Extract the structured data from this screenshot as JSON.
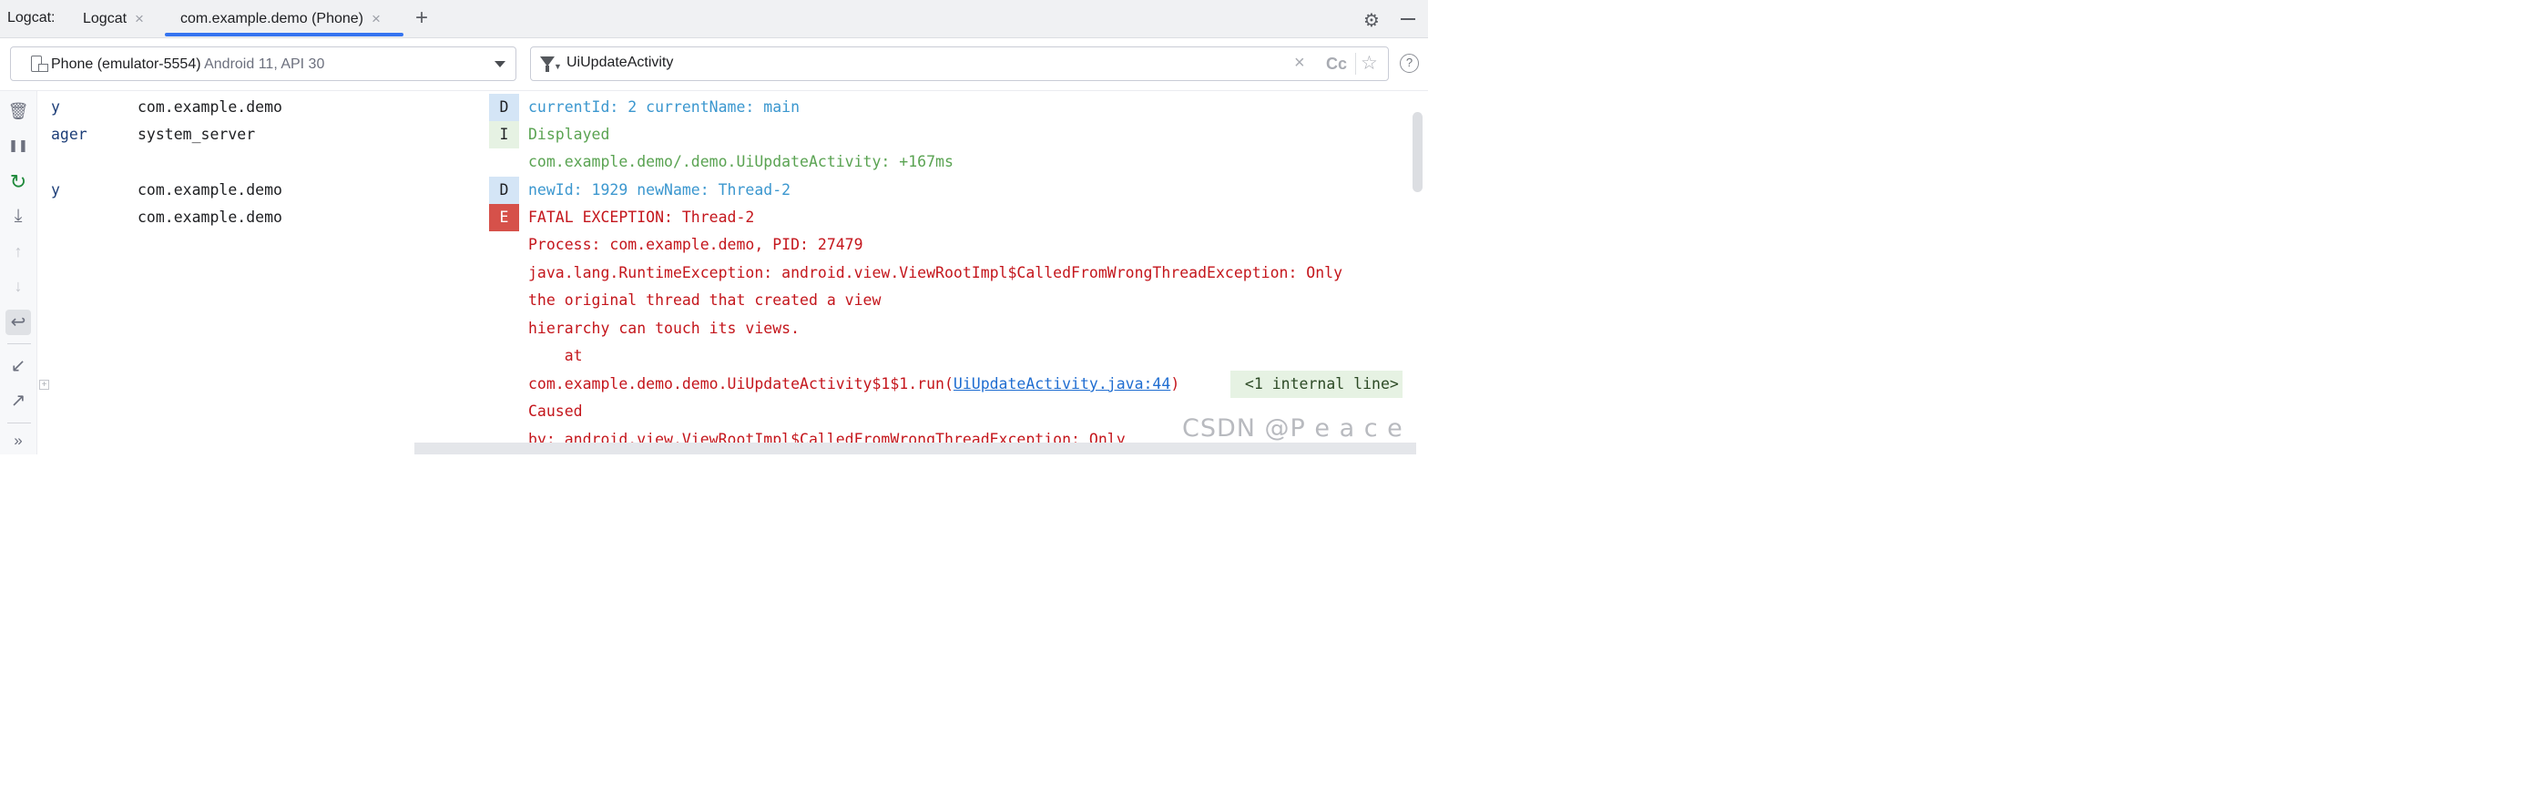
{
  "tool_window": {
    "title": "Logcat:",
    "tabs": [
      {
        "label": "Logcat",
        "active": false
      },
      {
        "label": "com.example.demo (Phone)",
        "active": true
      }
    ],
    "close_glyph": "×",
    "add_glyph": "+",
    "settings_glyph": "⚙"
  },
  "filter_bar": {
    "device_name": "Phone (emulator-5554)",
    "device_api": "Android 11, API 30",
    "query": "UiUpdateActivity",
    "clear_glyph": "×",
    "case_label": "Cc",
    "favorite_glyph": "☆",
    "help_glyph": "?"
  },
  "toolbar": {
    "clear_glyph": "🗑",
    "pause_glyph": "❚❚",
    "restart_glyph": "↻",
    "scroll_end_glyph": "⤓",
    "up_glyph": "↑",
    "down_glyph": "↓",
    "wrap_glyph": "↩",
    "import_glyph": "↙",
    "export_glyph": "↗",
    "more_glyph": "»"
  },
  "fold_glyph": "+",
  "log_entries": [
    {
      "tag": "y",
      "package": "com.example.demo",
      "level": "D",
      "lines": [
        "currentId: 2 currentName: main"
      ]
    },
    {
      "tag": "ager",
      "package": "system_server",
      "level": "I",
      "lines": [
        "Displayed",
        "com.example.demo/.demo.UiUpdateActivity: +167ms"
      ]
    },
    {
      "tag": "y",
      "package": "com.example.demo",
      "level": "D",
      "lines": [
        "newId: 1929 newName: Thread-2"
      ]
    },
    {
      "tag": "",
      "package": "com.example.demo",
      "level": "E",
      "lines": [
        "FATAL EXCEPTION: Thread-2",
        "Process: com.example.demo, PID: 27479",
        "java.lang.RuntimeException: android.view.ViewRootImpl$CalledFromWrongThreadException: Only",
        "the original thread that created a view",
        "hierarchy can touch its views.",
        "    at"
      ]
    }
  ],
  "stack_frame": {
    "prefix": "com.example.demo.demo.UiUpdateActivity$1$1.run(",
    "link": "UiUpdateActivity.java:44",
    "suffix": ")",
    "folded": " <1 internal line>"
  },
  "error_tail": [
    "Caused",
    "by: android.view.ViewRootImpl$CalledFromWrongThreadException: Only"
  ],
  "watermark": "CSDN @P e a c e",
  "colors": {
    "debug": "#3b97cf",
    "info": "#5aa352",
    "error": "#c4161c",
    "error_badge": "#d6514a",
    "tab_underline": "#3574f0"
  }
}
